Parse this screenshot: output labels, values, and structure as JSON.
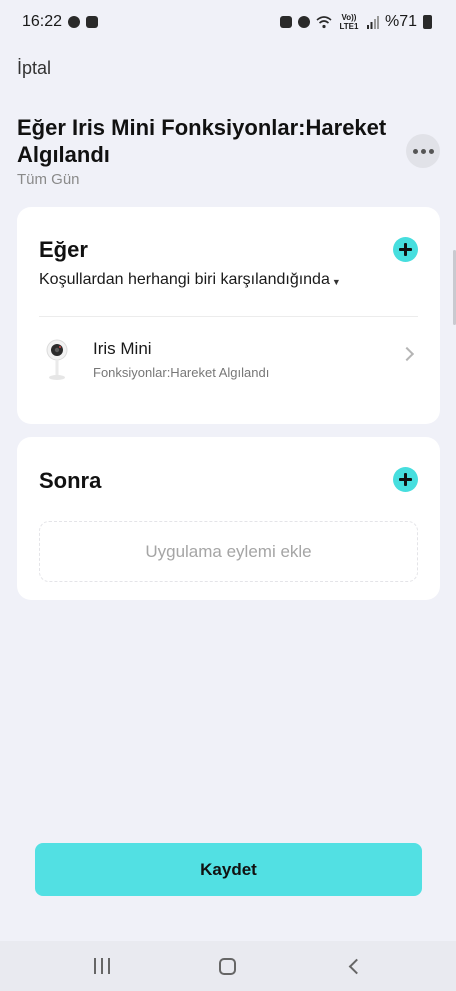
{
  "status_bar": {
    "time": "16:22",
    "network_label": "Vo)) LTE1",
    "battery": "%71",
    "left_icons": [
      "chat-bubble-icon",
      "screen-cast-icon"
    ],
    "right_icons": [
      "security-icon",
      "alarm-icon",
      "wifi-icon",
      "signal-icon",
      "battery-icon"
    ]
  },
  "header": {
    "cancel_label": "İptal",
    "title": "Eğer Iris Mini Fonksiyonlar:Hareket Algılandı",
    "subtitle": "Tüm Gün",
    "more_icon": "more-horizontal-icon"
  },
  "if_section": {
    "heading": "Eğer",
    "condition": "Koşullardan herhangi biri karşılandığında",
    "conditions": [
      {
        "device_name": "Iris Mini",
        "description": "Fonksiyonlar:Hareket Algılandı",
        "icon": "camera-device-icon"
      }
    ]
  },
  "then_section": {
    "heading": "Sonra",
    "empty_action_label": "Uygulama eylemi ekle"
  },
  "save_label": "Kaydet",
  "colors": {
    "accent": "#52e0e3",
    "add_button": "#46dede",
    "background": "#f0f1f8",
    "card": "#ffffff"
  },
  "nav_bar": [
    "recents-icon",
    "home-icon",
    "back-icon"
  ]
}
